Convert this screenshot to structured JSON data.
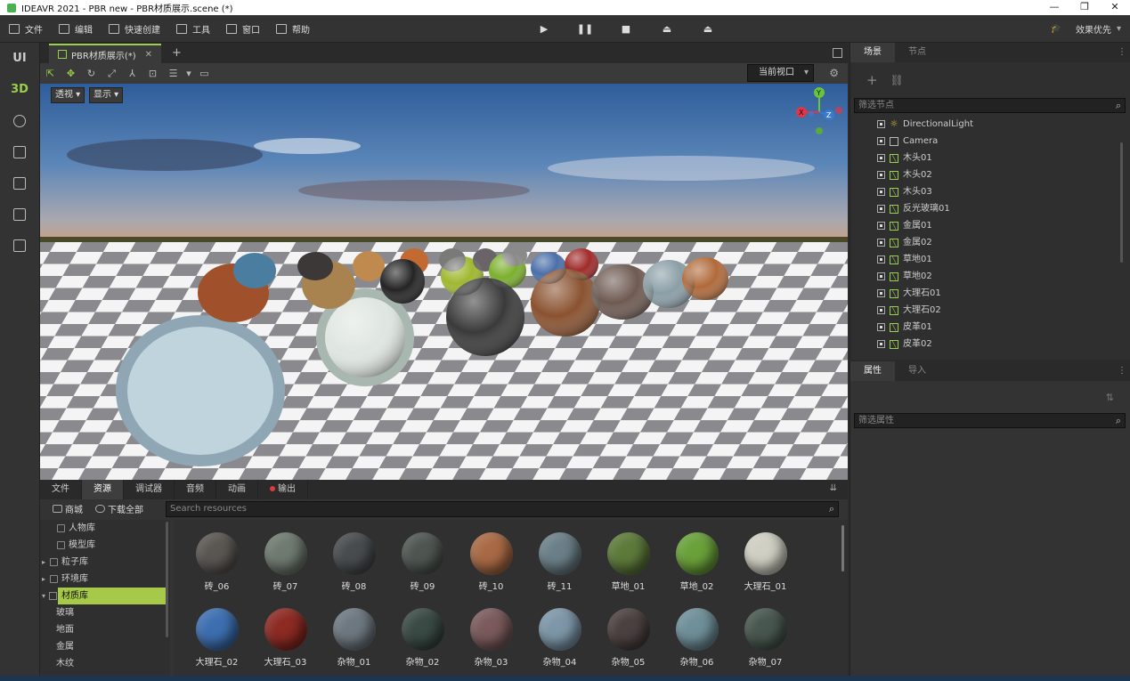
{
  "window": {
    "title": "IDEAVR 2021 - PBR new - PBR材质展示.scene (*)",
    "controls": [
      "—",
      "❐",
      "✕"
    ]
  },
  "menubar": {
    "items": [
      "文件",
      "编辑",
      "快速创建",
      "工具",
      "窗口",
      "帮助"
    ],
    "play_controls": [
      "▶",
      "❚❚",
      "■",
      "⏏",
      "⏏"
    ],
    "quality_label": "效果优先"
  },
  "leftbar": {
    "ui_label": "UI",
    "threed_label": "3D"
  },
  "document": {
    "tab_label": "PBR材质展示(*)",
    "view_select": "当前视口",
    "perspective_button": "透视",
    "display_button": "显示",
    "gizmo_labels": [
      "Y",
      "X",
      "Z"
    ]
  },
  "bottom_panel": {
    "tabs": [
      "文件",
      "资源",
      "调试器",
      "音频",
      "动画",
      "输出"
    ],
    "store_label": "商城",
    "download_all_label": "下载全部",
    "search_placeholder": "Search resources",
    "tree": [
      "人物库",
      "模型库",
      "粒子库",
      "环境库",
      "材质库",
      "玻璃",
      "地面",
      "金属",
      "木纹"
    ],
    "materials": [
      {
        "name": "砖_06",
        "color": "#5a5652"
      },
      {
        "name": "砖_07",
        "color": "#6f7a70"
      },
      {
        "name": "砖_08",
        "color": "#484c4f"
      },
      {
        "name": "砖_09",
        "color": "#4f5652"
      },
      {
        "name": "砖_10",
        "color": "#a86a45"
      },
      {
        "name": "砖_11",
        "color": "#6b7f88"
      },
      {
        "name": "草地_01",
        "color": "#5d7a3a"
      },
      {
        "name": "草地_02",
        "color": "#6aa13a"
      },
      {
        "name": "大理石_01",
        "color": "#cfcfc3"
      },
      {
        "name": "大理石_02",
        "color": "#3d6fb0"
      },
      {
        "name": "大理石_03",
        "color": "#8c2a23"
      },
      {
        "name": "杂物_01",
        "color": "#6e7880"
      },
      {
        "name": "杂物_02",
        "color": "#3a4a44"
      },
      {
        "name": "杂物_03",
        "color": "#7a5a5c"
      },
      {
        "name": "杂物_04",
        "color": "#7d97a8"
      },
      {
        "name": "杂物_05",
        "color": "#4b4140"
      },
      {
        "name": "杂物_06",
        "color": "#6f8f99"
      },
      {
        "name": "杂物_07",
        "color": "#48574f"
      }
    ]
  },
  "scene_panel": {
    "tabs": [
      "场景",
      "节点"
    ],
    "filter_placeholder": "筛选节点",
    "nodes": [
      {
        "name": "DirectionalLight",
        "type": "light"
      },
      {
        "name": "Camera",
        "type": "camera"
      },
      {
        "name": "木头01",
        "type": "mesh"
      },
      {
        "name": "木头02",
        "type": "mesh"
      },
      {
        "name": "木头03",
        "type": "mesh"
      },
      {
        "name": "反光玻璃01",
        "type": "mesh"
      },
      {
        "name": "金属01",
        "type": "mesh"
      },
      {
        "name": "金属02",
        "type": "mesh"
      },
      {
        "name": "草地01",
        "type": "mesh"
      },
      {
        "name": "草地02",
        "type": "mesh"
      },
      {
        "name": "大理石01",
        "type": "mesh"
      },
      {
        "name": "大理石02",
        "type": "mesh"
      },
      {
        "name": "皮革01",
        "type": "mesh"
      },
      {
        "name": "皮革02",
        "type": "mesh"
      }
    ]
  },
  "props_panel": {
    "tabs": [
      "属性",
      "导入"
    ],
    "filter_placeholder": "筛选属性"
  },
  "colors": {
    "accent": "#9bd04a",
    "selection": "#a6c94a",
    "panel": "#333333"
  }
}
